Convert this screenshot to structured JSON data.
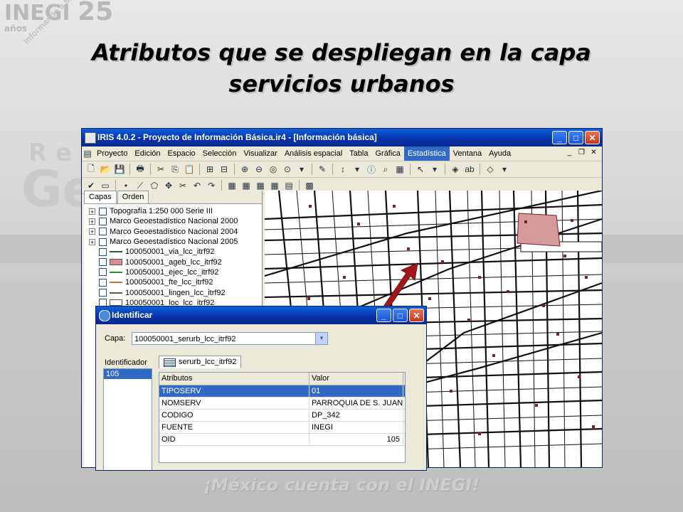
{
  "slide": {
    "title_line1": "Atributos que se despliegan en la capa",
    "title_line2": "servicios urbanos",
    "footer": "¡México cuenta con el INEGI!",
    "logo": {
      "brand": "INEGI",
      "years": "25",
      "years_suffix": "años",
      "tagline": "Informando a México"
    }
  },
  "window": {
    "title": "IRIS 4.0.2 - Proyecto de Información Básica.ir4 - [Información básica]",
    "menu": [
      "Proyecto",
      "Edición",
      "Espacio",
      "Selección",
      "Visualizar",
      "Análisis espacial",
      "Tabla",
      "Gráfica",
      "Estadística",
      "Ventana",
      "Ayuda"
    ],
    "active_menu": "Estadística",
    "tabs": {
      "capas": "Capas",
      "orden": "Orden"
    },
    "layers": [
      {
        "name": "Topografía 1:250 000 Serie III",
        "expand": "+",
        "symbol": "none"
      },
      {
        "name": "Marco Geoestadístico Nacional 2000",
        "expand": "+",
        "symbol": "none"
      },
      {
        "name": "Marco Geoestadístico Nacional 2004",
        "expand": "+",
        "symbol": "none"
      },
      {
        "name": "Marco Geoestadístico Nacional 2005",
        "expand": "+",
        "symbol": "none"
      },
      {
        "name": "100050001_via_lcc_itrf92",
        "expand": "",
        "symbol": "line",
        "color": "#2e5e2e"
      },
      {
        "name": "100050001_ageb_lcc_itrf92",
        "expand": "",
        "symbol": "fill",
        "color": "#d98c9a"
      },
      {
        "name": "100050001_ejec_lcc_itrf92",
        "expand": "",
        "symbol": "line",
        "color": "#2e8b2e"
      },
      {
        "name": "100050001_fte_lcc_itrf92",
        "expand": "",
        "symbol": "line",
        "color": "#b87a2a"
      },
      {
        "name": "100050001_lingen_lcc_itrf92",
        "expand": "",
        "symbol": "line",
        "color": "#6b5a3a"
      },
      {
        "name": "100050001_loc_lcc_itrf92",
        "expand": "",
        "symbol": "fill",
        "color": "#ffffff"
      }
    ]
  },
  "identify": {
    "title": "Identificar",
    "layer_label": "Capa:",
    "layer_value": "100050001_serurb_lcc_itrf92",
    "id_label": "Identificador",
    "id_items": [
      "105"
    ],
    "tab_label": "serurb_lcc_itrf92",
    "columns": [
      "Atributos",
      "Valor"
    ],
    "rows": [
      {
        "attr": "TIPOSERV",
        "value": "01"
      },
      {
        "attr": "NOMSERV",
        "value": "PARROQUIA DE S. JUAN I"
      },
      {
        "attr": "CODIGO",
        "value": "DP_342"
      },
      {
        "attr": "FUENTE",
        "value": "INEGI"
      },
      {
        "attr": "OID",
        "value": "105"
      }
    ]
  },
  "colors": {
    "title_bar": "#0a5fd8",
    "selection": "#316ac5",
    "arrow": "#a3161b",
    "map_point": "#7a1f2b",
    "ageb_fill": "#d59a9a"
  }
}
